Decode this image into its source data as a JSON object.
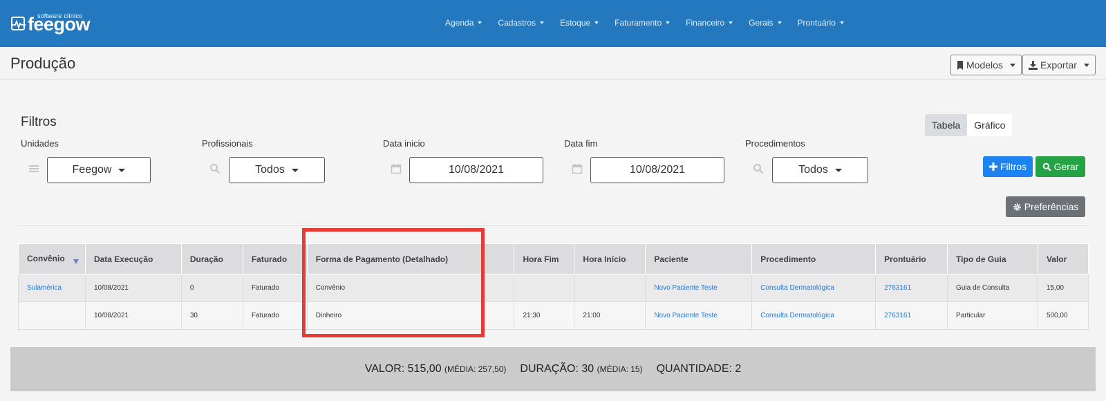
{
  "brand": {
    "tagline": "software clínico",
    "name": "feegow"
  },
  "nav": [
    "Agenda",
    "Cadastros",
    "Estoque",
    "Faturamento",
    "Financeiro",
    "Gerais",
    "Prontuário"
  ],
  "page": {
    "title": "Produção",
    "models_label": "Modelos",
    "export_label": "Exportar"
  },
  "filters": {
    "title": "Filtros",
    "unidades": {
      "label": "Unidades",
      "value": "Feegow"
    },
    "profissionais": {
      "label": "Profissionais",
      "value": "Todos"
    },
    "data_inicio": {
      "label": "Data inicio",
      "value": "10/08/2021"
    },
    "data_fim": {
      "label": "Data fim",
      "value": "10/08/2021"
    },
    "procedimentos": {
      "label": "Procedimentos",
      "value": "Todos"
    }
  },
  "view_toggle": {
    "table": "Tabela",
    "chart": "Gráfico"
  },
  "buttons": {
    "filtros": "Filtros",
    "gerar": "Gerar",
    "preferencias": "Preferências"
  },
  "table": {
    "headers": [
      "Convênio",
      "Data Execução",
      "Duração",
      "Faturado",
      "Forma de Pagamento (Detalhado)",
      "",
      "Hora Fim",
      "Hora Início",
      "Paciente",
      "Procedimento",
      "Prontuário",
      "Tipo de Guia",
      "Valor"
    ],
    "rows": [
      [
        "Sulamérica",
        "10/08/2021",
        "0",
        "Faturado",
        "Convênio",
        "",
        "",
        "",
        "Novo Paciente Teste",
        "Consulta Dermatológica",
        "2763161",
        "Guia de Consulta",
        "15,00"
      ],
      [
        "",
        "10/08/2021",
        "30",
        "Faturado",
        "Dinheiro",
        "",
        "21:30",
        "21:00",
        "Novo Paciente Teste",
        "Consulta Dermatológica",
        "2763161",
        "Particular",
        "500,00"
      ]
    ]
  },
  "summary": {
    "valor": "VALOR: 515,00",
    "valor_media": "(MÉDIA: 257,50)",
    "duracao": "DURAÇÃO: 30",
    "duracao_media": "(MÉDIA: 15)",
    "quantidade": "QUANTIDADE: 2"
  },
  "colors": {
    "topbar": "#2478bd",
    "primary": "#1c83f0",
    "success": "#25a244",
    "highlight": "#e53b34",
    "link": "#2478d8"
  }
}
